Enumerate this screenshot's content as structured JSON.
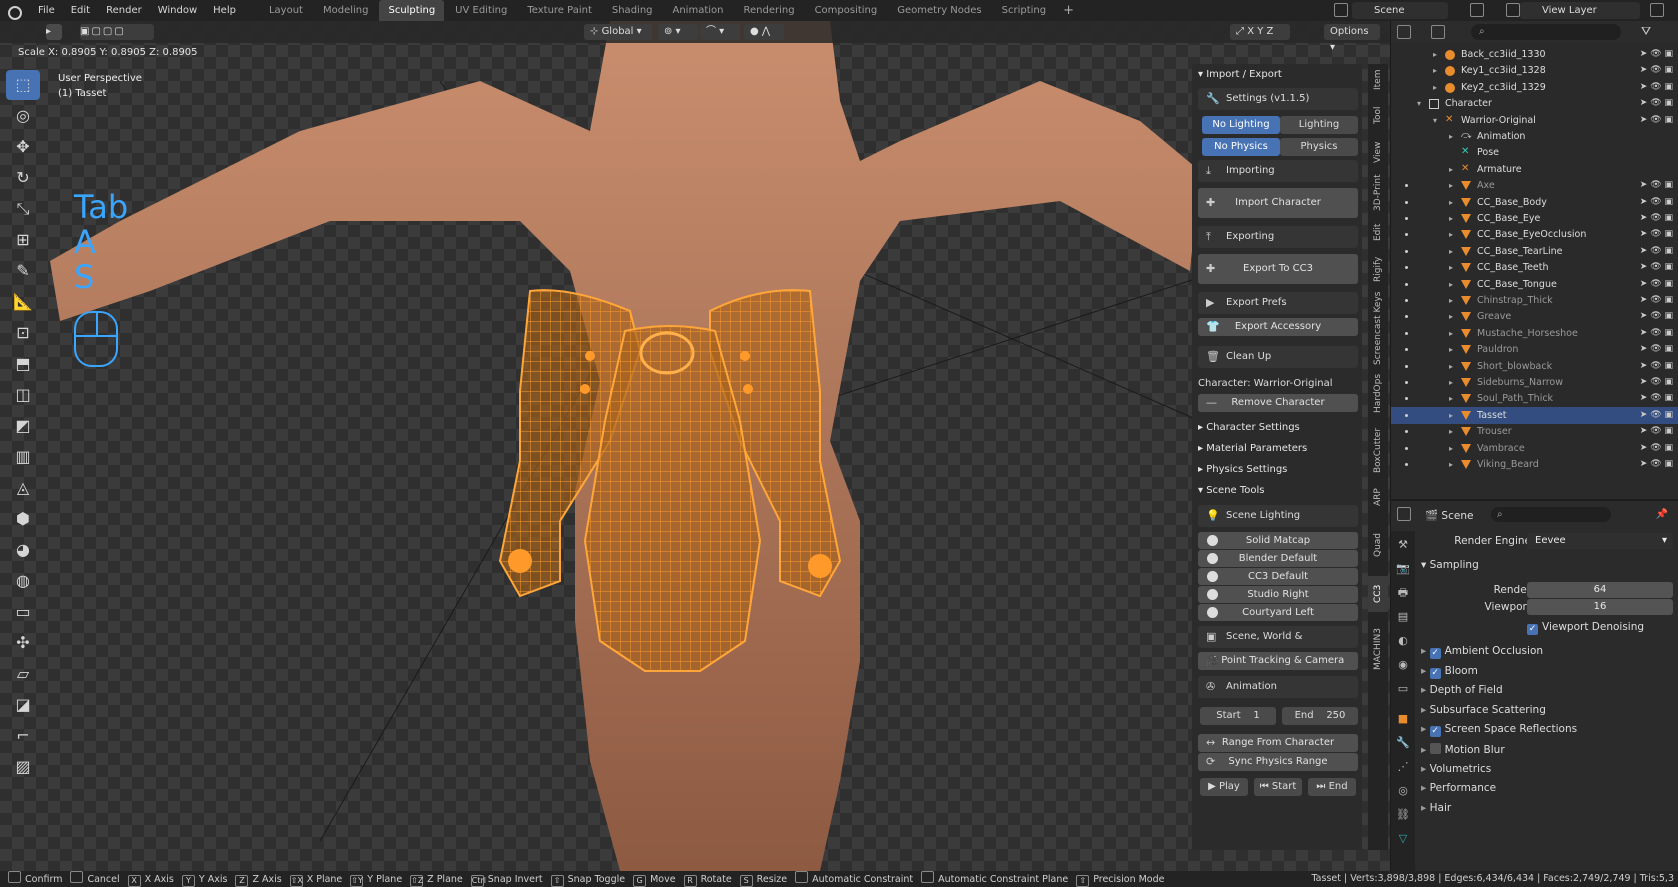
{
  "menu": [
    "File",
    "Edit",
    "Render",
    "Window",
    "Help"
  ],
  "workspaces": [
    "Layout",
    "Modeling",
    "Sculpting",
    "UV Editing",
    "Texture Paint",
    "Shading",
    "Animation",
    "Rendering",
    "Compositing",
    "Geometry Nodes",
    "Scripting"
  ],
  "active_workspace": "Sculpting",
  "scene_name": "Scene",
  "view_layer": "View Layer",
  "viewport": {
    "orientation": "Global",
    "axes": [
      "X",
      "Y",
      "Z"
    ],
    "options_label": "Options",
    "scale_info": "Scale X: 0.8905   Y: 0.8905   Z: 0.8905",
    "perspective": "User Perspective",
    "object": "(1) Tasset",
    "keys": [
      "Tab",
      "A",
      "S"
    ]
  },
  "npanel": {
    "header": "Import / Export",
    "settings": "Settings  (v1.1.5)",
    "no_lighting": "No Lighting",
    "lighting": "Lighting",
    "no_physics": "No Physics",
    "physics": "Physics",
    "importing": "Importing",
    "import_character": "Import Character",
    "exporting": "Exporting",
    "export_cc3": "Export To CC3",
    "export_prefs": "Export Prefs",
    "export_accessory": "Export Accessory",
    "clean_up": "Clean Up",
    "character_label": "Character: Warrior-Original",
    "remove_character": "Remove Character",
    "character_settings": "Character Settings",
    "material_parameters": "Material Parameters",
    "physics_settings": "Physics Settings",
    "scene_tools": "Scene Tools",
    "scene_lighting": "Scene Lighting",
    "lighting_presets": [
      "Solid Matcap",
      "Blender Default",
      "CC3 Default",
      "Studio Right",
      "Courtyard Left"
    ],
    "scene_world": "Scene, World & Compositor",
    "tracking": "3 Point Tracking & Camera",
    "animation": "Animation",
    "start_label": "Start",
    "start_value": "1",
    "end_label": "End",
    "end_value": "250",
    "range_from_char": "Range From Character",
    "sync_physics": "Sync Physics Range",
    "play": "Play",
    "start_btn": "Start",
    "end_btn": "End",
    "tabs": [
      "Item",
      "Tool",
      "View",
      "3D-Print",
      "Edit",
      "Rigify",
      "Screencast Keys",
      "HardOps",
      "BoxCutter",
      "ARP",
      "Quad Remesh",
      "CC3",
      "MACHIN3"
    ]
  },
  "outliner": {
    "rows": [
      {
        "name": "Back_cc3iid_1330",
        "type": "shape",
        "indent": 2
      },
      {
        "name": "Key1_cc3iid_1328",
        "type": "shape",
        "indent": 2
      },
      {
        "name": "Key2_cc3iid_1329",
        "type": "shape",
        "indent": 2
      },
      {
        "name": "Character",
        "type": "collection",
        "indent": 1
      },
      {
        "name": "Warrior-Original",
        "type": "armature",
        "indent": 2
      },
      {
        "name": "Animation",
        "type": "anim",
        "indent": 3
      },
      {
        "name": "Pose",
        "type": "pose",
        "indent": 3
      },
      {
        "name": "Armature",
        "type": "armature",
        "indent": 3
      },
      {
        "name": "Axe",
        "type": "mesh",
        "indent": 3,
        "dim": true
      },
      {
        "name": "CC_Base_Body",
        "type": "mesh",
        "indent": 3
      },
      {
        "name": "CC_Base_Eye",
        "type": "mesh",
        "indent": 3
      },
      {
        "name": "CC_Base_EyeOcclusion",
        "type": "mesh",
        "indent": 3
      },
      {
        "name": "CC_Base_TearLine",
        "type": "mesh",
        "indent": 3
      },
      {
        "name": "CC_Base_Teeth",
        "type": "mesh",
        "indent": 3
      },
      {
        "name": "CC_Base_Tongue",
        "type": "mesh",
        "indent": 3
      },
      {
        "name": "Chinstrap_Thick",
        "type": "mesh",
        "indent": 3,
        "dim": true
      },
      {
        "name": "Greave",
        "type": "mesh",
        "indent": 3,
        "dim": true
      },
      {
        "name": "Mustache_Horseshoe",
        "type": "mesh",
        "indent": 3,
        "dim": true
      },
      {
        "name": "Pauldron",
        "type": "mesh",
        "indent": 3,
        "dim": true
      },
      {
        "name": "Short_blowback",
        "type": "mesh",
        "indent": 3,
        "dim": true
      },
      {
        "name": "Sideburns_Narrow",
        "type": "mesh",
        "indent": 3,
        "dim": true
      },
      {
        "name": "Soul_Path_Thick",
        "type": "mesh",
        "indent": 3,
        "dim": true
      },
      {
        "name": "Tasset",
        "type": "mesh",
        "indent": 3,
        "selected": true
      },
      {
        "name": "Trouser",
        "type": "mesh",
        "indent": 3,
        "dim": true
      },
      {
        "name": "Vambrace",
        "type": "mesh",
        "indent": 3,
        "dim": true
      },
      {
        "name": "Viking_Beard",
        "type": "mesh",
        "indent": 3,
        "dim": true
      }
    ]
  },
  "properties": {
    "scene": "Scene",
    "render_engine_label": "Render Engine",
    "render_engine": "Eevee",
    "sampling": "Sampling",
    "render_label": "Render",
    "render_value": "64",
    "viewport_label": "Viewport",
    "viewport_value": "16",
    "viewport_denoising": "Viewport Denoising",
    "panels": [
      {
        "label": "Ambient Occlusion",
        "check": true
      },
      {
        "label": "Bloom",
        "check": true
      },
      {
        "label": "Depth of Field",
        "check": null
      },
      {
        "label": "Subsurface Scattering",
        "check": null
      },
      {
        "label": "Screen Space Reflections",
        "check": true
      },
      {
        "label": "Motion Blur",
        "check": false
      },
      {
        "label": "Volumetrics",
        "check": null
      },
      {
        "label": "Performance",
        "check": null
      },
      {
        "label": "Hair",
        "check": null
      }
    ]
  },
  "statusbar": {
    "items": [
      {
        "key": "",
        "label": "Confirm"
      },
      {
        "key": "",
        "label": "Cancel"
      },
      {
        "key": "X",
        "label": "X Axis"
      },
      {
        "key": "Y",
        "label": "Y Axis"
      },
      {
        "key": "Z",
        "label": "Z Axis"
      },
      {
        "key": "⇧X",
        "label": "X Plane"
      },
      {
        "key": "⇧Y",
        "label": "Y Plane"
      },
      {
        "key": "⇧Z",
        "label": "Z Plane"
      },
      {
        "key": "Ctrl",
        "label": "Snap Invert"
      },
      {
        "key": "⇧",
        "label": "Snap Toggle"
      },
      {
        "key": "G",
        "label": "Move"
      },
      {
        "key": "R",
        "label": "Rotate"
      },
      {
        "key": "S",
        "label": "Resize"
      },
      {
        "key": "",
        "label": "Automatic Constraint"
      },
      {
        "key": "",
        "label": "Automatic Constraint Plane"
      },
      {
        "key": "⇧",
        "label": "Precision Mode"
      }
    ],
    "stats": "Tasset | Verts:3,898/3,898 | Edges:6,434/6,434 | Faces:2,749/2,749 | Tris:5,3"
  },
  "colors": {
    "accent": "#4772b3",
    "selection_orange": "#ff8c1a",
    "keys_blue": "#3aa6ff"
  }
}
